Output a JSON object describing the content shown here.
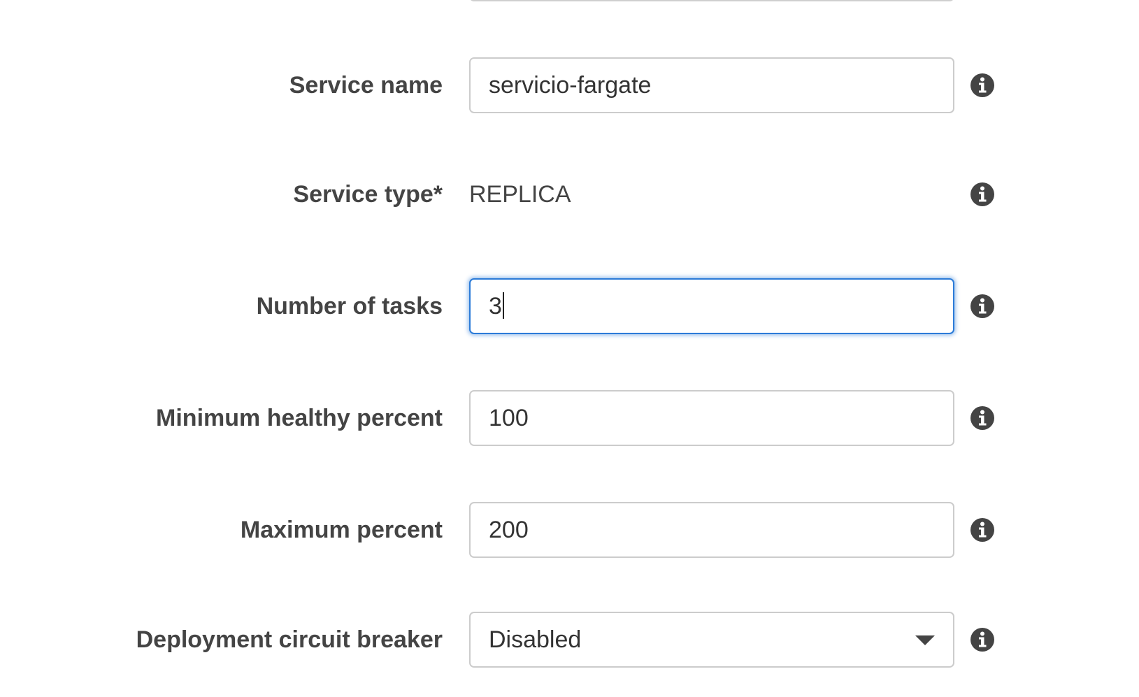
{
  "fields": {
    "service_name": {
      "label": "Service name",
      "value": "servicio-fargate"
    },
    "service_type": {
      "label": "Service type*",
      "value": "REPLICA"
    },
    "number_of_tasks": {
      "label": "Number of tasks",
      "value": "3"
    },
    "minimum_healthy_percent": {
      "label": "Minimum healthy percent",
      "value": "100"
    },
    "maximum_percent": {
      "label": "Maximum percent",
      "value": "200"
    },
    "deployment_circuit_breaker": {
      "label": "Deployment circuit breaker",
      "value": "Disabled"
    }
  },
  "icons": {
    "info": "info-icon"
  },
  "colors": {
    "label_text": "#444444",
    "input_border": "#cccccc",
    "focus_border": "#2b7bd8",
    "icon_fill": "#444444"
  }
}
